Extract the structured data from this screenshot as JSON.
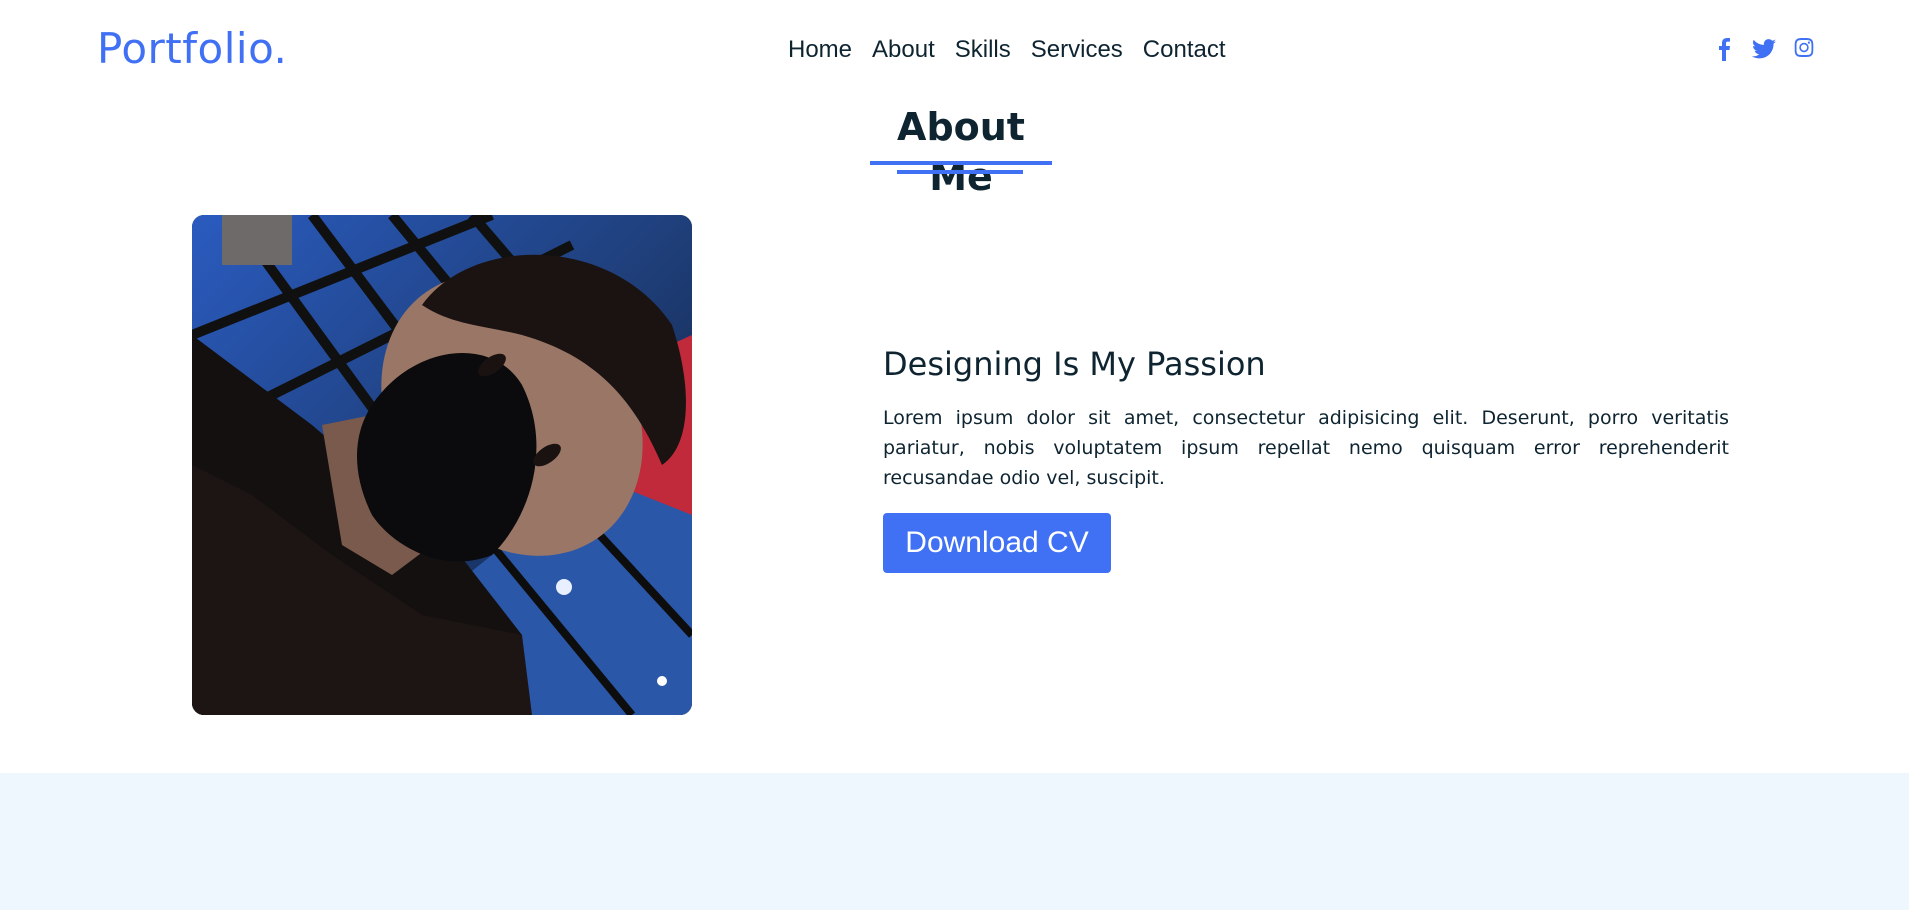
{
  "header": {
    "logo": "Portfolio.",
    "nav": [
      "Home",
      "About",
      "Skills",
      "Services",
      "Contact"
    ],
    "social_icons": [
      "facebook-icon",
      "twitter-icon",
      "instagram-icon"
    ]
  },
  "about": {
    "title": "About Me",
    "heading": "Designing Is My Passion",
    "paragraph": "Lorem ipsum dolor sit amet, consectetur adipisicing elit. Deserunt, porro veritatis pariatur, nobis voluptatem ipsum repellat nemo quisquam error reprehenderit recusandae odio vel, suscipit.",
    "button": "Download CV"
  },
  "colors": {
    "accent": "#4070f4",
    "text": "#0e2431",
    "band": "#eef6fe"
  }
}
